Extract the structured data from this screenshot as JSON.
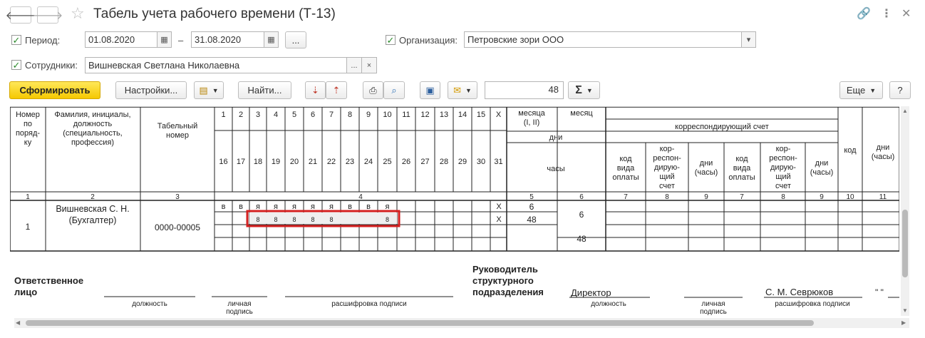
{
  "window": {
    "title": "Табель учета рабочего времени (Т-13)"
  },
  "filters": {
    "period_label": "Период:",
    "date_from": "01.08.2020",
    "dash": "–",
    "date_to": "31.08.2020",
    "dots": "...",
    "org_label": "Организация:",
    "org_value": "Петровские зори ООО",
    "emp_label": "Сотрудники:",
    "emp_value": "Вишневская Светлана Николаевна",
    "clear": "×"
  },
  "toolbar": {
    "generate": "Сформировать",
    "settings": "Настройки...",
    "find": "Найти...",
    "number": "48",
    "more": "Еще",
    "help": "?"
  },
  "report": {
    "headers": {
      "col1": [
        "Номер",
        "по",
        "поряд-",
        "ку"
      ],
      "col2": [
        "Фамилия, инициалы,",
        "должность",
        "(специальность,",
        "профессия)"
      ],
      "col3": [
        "Табельный",
        "номер"
      ],
      "days_top": [
        "1",
        "2",
        "3",
        "4",
        "5",
        "6",
        "7",
        "8",
        "9",
        "10",
        "11",
        "12",
        "13",
        "14",
        "15",
        "X"
      ],
      "days_bottom": [
        "16",
        "17",
        "18",
        "19",
        "20",
        "21",
        "22",
        "23",
        "24",
        "25",
        "26",
        "27",
        "28",
        "29",
        "30",
        "31"
      ],
      "month_half": [
        "месяца",
        "(I, II)"
      ],
      "month": "месяц",
      "days": "дни",
      "hours": "часы",
      "corr_account": "корреспондирующий счет",
      "pay_code": [
        "код",
        "вида",
        "оплаты"
      ],
      "corr": [
        "кор-",
        "респон-",
        "дирую-",
        "щий",
        "счет"
      ],
      "days_hours": [
        "дни",
        "(часы)"
      ],
      "code": "код",
      "nums": [
        "1",
        "2",
        "3",
        "4",
        "5",
        "6",
        "7",
        "8",
        "9",
        "7",
        "8",
        "9",
        "10",
        "11"
      ]
    },
    "row": {
      "num": "1",
      "name": [
        "Вишневская С. Н.",
        "(Бухгалтер)"
      ],
      "tab_num": "0000-00005",
      "marks": [
        "в",
        "в",
        "я",
        "я",
        "я",
        "я",
        "я",
        "в",
        "в",
        "я"
      ],
      "hours": [
        "8",
        "8",
        "8",
        "8",
        "8",
        "8"
      ],
      "x1": "X",
      "x2": "X",
      "d_half": "6",
      "h_half": "48",
      "d_month": "6",
      "h_month": "48"
    },
    "signatures": {
      "responsible": [
        "Ответственное",
        "лицо"
      ],
      "position": "должность",
      "personal_sig": [
        "личная",
        "подпись"
      ],
      "sig_decode": "расшифровка подписи",
      "head": [
        "Руководитель",
        "структурного",
        "подразделения"
      ],
      "director": "Директор",
      "head_name": "С. М. Севрюков",
      "quote": "\" \""
    }
  },
  "colors": {
    "accent": "#f5c800",
    "highlight": "#d42020",
    "check": "#2b8a2b"
  }
}
